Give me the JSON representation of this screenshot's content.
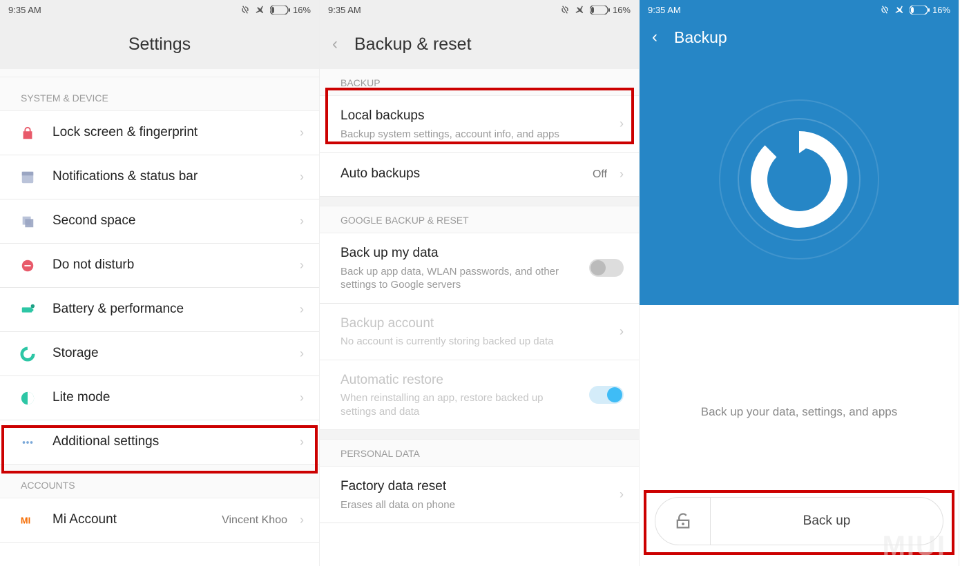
{
  "status": {
    "time": "9:35 AM",
    "battery": "16%"
  },
  "s1": {
    "title": "Settings",
    "section1": "SYSTEM & DEVICE",
    "items": [
      {
        "label": "Lock screen & fingerprint"
      },
      {
        "label": "Notifications & status bar"
      },
      {
        "label": "Second space"
      },
      {
        "label": "Do not disturb"
      },
      {
        "label": "Battery & performance"
      },
      {
        "label": "Storage"
      },
      {
        "label": "Lite mode"
      },
      {
        "label": "Additional settings"
      }
    ],
    "section2": "ACCOUNTS",
    "mi_account": "Mi Account",
    "mi_account_value": "Vincent Khoo"
  },
  "s2": {
    "title": "Backup & reset",
    "section_backup": "BACKUP",
    "local_backups": "Local backups",
    "local_backups_sub": "Backup system settings, account info, and apps",
    "auto_backups": "Auto backups",
    "auto_backups_value": "Off",
    "section_google": "GOOGLE BACKUP & RESET",
    "backup_my_data": "Back up my data",
    "backup_my_data_sub": "Back up app data, WLAN passwords, and other settings to Google servers",
    "backup_account": "Backup account",
    "backup_account_sub": "No account is currently storing backed up data",
    "auto_restore": "Automatic restore",
    "auto_restore_sub": "When reinstalling an app, restore backed up settings and data",
    "section_personal": "PERSONAL DATA",
    "factory_reset": "Factory data reset",
    "factory_reset_sub": "Erases all data on phone"
  },
  "s3": {
    "title": "Backup",
    "caption": "Back up your data, settings, and apps",
    "button": "Back up"
  },
  "watermark": "MIUI"
}
